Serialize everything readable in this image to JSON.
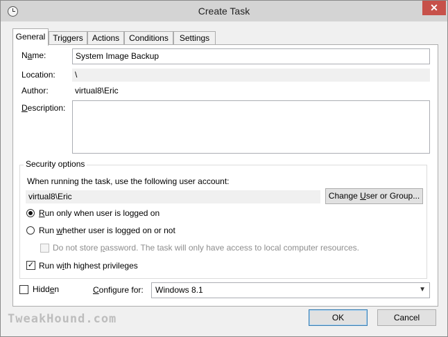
{
  "window": {
    "title": "Create Task",
    "close_glyph": "✕"
  },
  "tabs": [
    {
      "label": "General",
      "active": true
    },
    {
      "label": "Triggers",
      "active": false
    },
    {
      "label": "Actions",
      "active": false
    },
    {
      "label": "Conditions",
      "active": false
    },
    {
      "label": "Settings",
      "active": false
    }
  ],
  "general": {
    "name_label_pre": "N",
    "name_label_u": "a",
    "name_label_post": "me:",
    "name_value": "System Image Backup",
    "location_label": "Location:",
    "location_value": "\\",
    "author_label": "Author:",
    "author_value": "virtual8\\Eric",
    "description_label_u": "D",
    "description_label_post": "escription:",
    "description_value": ""
  },
  "security": {
    "group_title": "Security options",
    "account_prompt": "When running the task, use the following user account:",
    "account_value": "virtual8\\Eric",
    "change_button_pre": "Change ",
    "change_button_u": "U",
    "change_button_post": "ser or Group...",
    "radio_logged_on_u": "R",
    "radio_logged_on_post": "un only when user is logged on",
    "radio_logged_on_checked": true,
    "radio_whether_pre": "Run ",
    "radio_whether_u": "w",
    "radio_whether_post": "hether user is logged on or not",
    "radio_whether_checked": false,
    "no_store_pre": "Do not store ",
    "no_store_u": "p",
    "no_store_post": "assword.  The task will only have access to local computer resources.",
    "no_store_checked": false,
    "highest_pre": "Run w",
    "highest_u": "i",
    "highest_post": "th highest privileges",
    "highest_checked": true,
    "check_glyph": "✓"
  },
  "footer": {
    "hidden_pre": "Hidd",
    "hidden_u": "e",
    "hidden_post": "n",
    "hidden_checked": false,
    "configure_label_pre": "",
    "configure_label_u": "C",
    "configure_label_post": "onfigure for:",
    "configure_value": "Windows 8.1",
    "ok_label": "OK",
    "cancel_label": "Cancel",
    "watermark": "TweakHound.com"
  }
}
